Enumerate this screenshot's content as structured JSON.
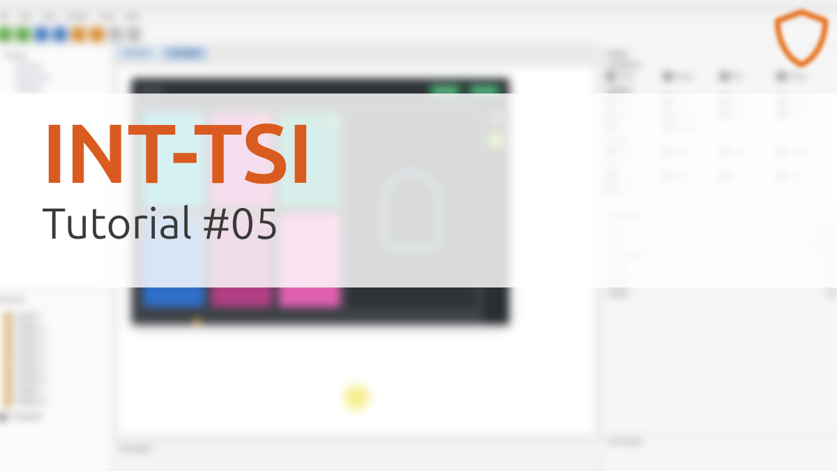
{
  "overlay": {
    "title": "INT-TSI",
    "subtitle": "Tutorial #05"
  },
  "app": {
    "menus": [
      "File",
      "Edit",
      "View",
      "Project",
      "Tools",
      "Help"
    ],
    "tabs": {
      "tab1": "Screen1",
      "tab2": "Template"
    },
    "hmi": {
      "label": "System",
      "status1": "Ready",
      "status2": "Armed"
    },
    "palette": {
      "title": "Palette",
      "sections": [
        {
          "name": "Containers",
          "items": [
            "Panel",
            "Group",
            "Tab",
            "Frame"
          ]
        },
        {
          "name": "Widgets",
          "items": [
            "Button",
            "Label",
            "Icon",
            "Image",
            "Slider",
            "Switch",
            "Text",
            "Clock",
            "List",
            "Keypad"
          ]
        },
        {
          "name": "System",
          "items": [
            "Zone",
            "Output",
            "Macro",
            "Partition"
          ]
        },
        {
          "name": "Other",
          "items": [
            "Link",
            "Script",
            "Var",
            "Timer",
            "Event"
          ]
        }
      ]
    },
    "props": {
      "title": "Properties",
      "rows": [
        {
          "k": "Name",
          "v": "Screen1"
        },
        {
          "k": "Type",
          "v": "Template"
        },
        {
          "k": "Background",
          "v": "default"
        },
        {
          "k": "Width",
          "v": "800"
        },
        {
          "k": "Height",
          "v": "480"
        },
        {
          "k": "Visible",
          "v": "true"
        }
      ]
    },
    "structure": {
      "header": "Structure",
      "root": "System",
      "items": [
        "Widget_1",
        "Widget_2",
        "Widget_3",
        "Widget_4",
        "Widget_5",
        "Widget_6",
        "Widget_7",
        "Widget_8"
      ],
      "other": "Templates"
    },
    "tree": {
      "root": "Project",
      "children": [
        "Screens",
        "Resources",
        "Settings"
      ]
    },
    "footer": "Messages",
    "info": "Information"
  }
}
